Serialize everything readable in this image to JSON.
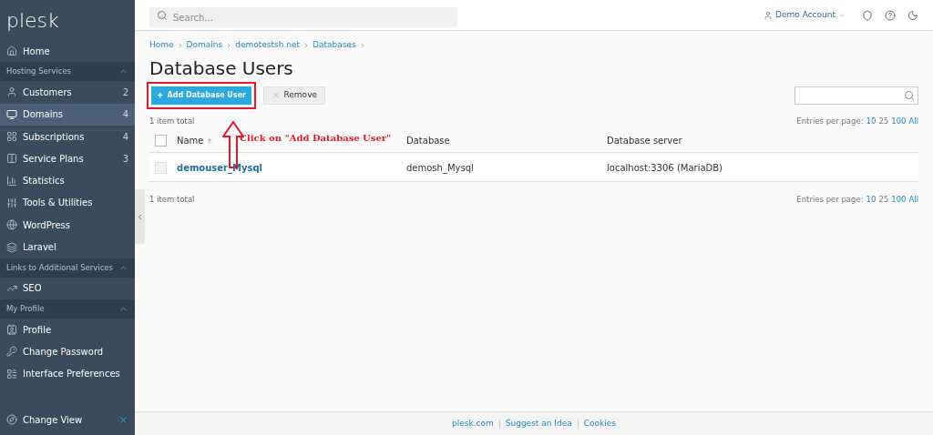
{
  "sidebar": {
    "logo": "plesk",
    "entries": [
      {
        "kind": "item",
        "label": "Home",
        "selected": false
      },
      {
        "kind": "section",
        "label": "Hosting Services",
        "expanded": true
      },
      {
        "kind": "item",
        "label": "Customers",
        "count": "2",
        "selected": false
      },
      {
        "kind": "item",
        "label": "Domains",
        "count": "4",
        "selected": true
      },
      {
        "kind": "item",
        "label": "Subscriptions",
        "count": "4",
        "selected": false
      },
      {
        "kind": "item",
        "label": "Service Plans",
        "count": "3",
        "selected": false
      },
      {
        "kind": "item",
        "label": "Statistics",
        "selected": false
      },
      {
        "kind": "item",
        "label": "Tools & Utilities",
        "selected": false
      },
      {
        "kind": "item",
        "label": "WordPress",
        "selected": false
      },
      {
        "kind": "item",
        "label": "Laravel",
        "selected": false
      },
      {
        "kind": "section",
        "label": "Links to Additional Services",
        "expanded": true
      },
      {
        "kind": "item",
        "label": "SEO",
        "selected": false
      },
      {
        "kind": "section",
        "label": "My Profile",
        "expanded": true
      },
      {
        "kind": "item",
        "label": "Profile",
        "selected": false
      },
      {
        "kind": "item",
        "label": "Change Password",
        "selected": false
      },
      {
        "kind": "item",
        "label": "Interface Preferences",
        "selected": false
      }
    ],
    "footer": "Change View"
  },
  "topbar": {
    "search_placeholder": "Search...",
    "account": "Demo Account"
  },
  "breadcrumbs": [
    "Home",
    "Domains",
    "demotestsh.net",
    "Databases"
  ],
  "title": "Database Users",
  "toolbar": {
    "add": "Add Database User",
    "remove": "Remove"
  },
  "annotation": "Click on \"Add Database User\"",
  "items_total": [
    "1 item total",
    "1 item total"
  ],
  "entries_per_page": [
    {
      "label": "Entries per page:",
      "options": [
        {
          "label": "10",
          "selected": false
        },
        {
          "label": "25",
          "selected": true
        },
        {
          "label": "100",
          "selected": false
        },
        {
          "label": "All",
          "selected": false
        }
      ]
    },
    {
      "label": "Entries per page:",
      "options": [
        {
          "label": "10",
          "selected": false
        },
        {
          "label": "25",
          "selected": true
        },
        {
          "label": "100",
          "selected": false
        },
        {
          "label": "All",
          "selected": false
        }
      ]
    }
  ],
  "table": {
    "all_checked": false,
    "columns": [
      "Name",
      "Database",
      "Database server"
    ],
    "rows": [
      {
        "checked": false,
        "name": "demouser_Mysql",
        "database": "demosh_Mysql",
        "server": "localhost:3306 (MariaDB)"
      }
    ]
  },
  "footer_links": [
    "plesk.com",
    "Suggest an Idea",
    "Cookies"
  ]
}
